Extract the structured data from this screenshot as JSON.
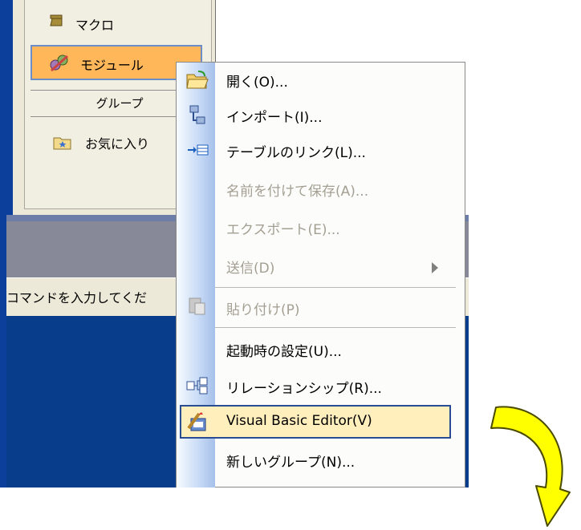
{
  "window": {
    "object_list": {
      "items": [
        {
          "label": "マクロ",
          "icon": "macro-scroll-icon"
        },
        {
          "label": "モジュール",
          "icon": "module-gears-icon",
          "selected": true
        }
      ],
      "group_header": "グループ",
      "favorites": {
        "label": "お気に入り",
        "icon": "favorites-folder-icon"
      }
    },
    "status_bar": {
      "text": "コマンドを入力してくだ"
    }
  },
  "context_menu": {
    "items": [
      {
        "label": "開く(O)...",
        "enabled": true,
        "icon": "open-folder-icon"
      },
      {
        "label": "インポート(I)...",
        "enabled": true,
        "icon": "import-icon"
      },
      {
        "label": "テーブルのリンク(L)...",
        "enabled": true,
        "icon": "link-table-icon"
      },
      {
        "label": "名前を付けて保存(A)...",
        "enabled": false
      },
      {
        "label": "エクスポート(E)...",
        "enabled": false
      },
      {
        "label": "送信(D)",
        "enabled": false,
        "has_submenu": true
      },
      {
        "label": "貼り付け(P)",
        "enabled": false,
        "icon": "paste-icon"
      },
      {
        "label": "起動時の設定(U)...",
        "enabled": true
      },
      {
        "label": "リレーションシップ(R)...",
        "enabled": true,
        "icon": "relationships-icon"
      },
      {
        "label": "Visual Basic Editor(V)",
        "enabled": true,
        "highlighted": true,
        "icon": "vbe-icon"
      },
      {
        "label": "新しいグループ(N)...",
        "enabled": true
      }
    ]
  },
  "colors": {
    "menu_highlight": "#ffefbd",
    "selected_item": "#ffb75a",
    "arrow_fill": "#ffff00",
    "window_blue": "#073d8b"
  }
}
